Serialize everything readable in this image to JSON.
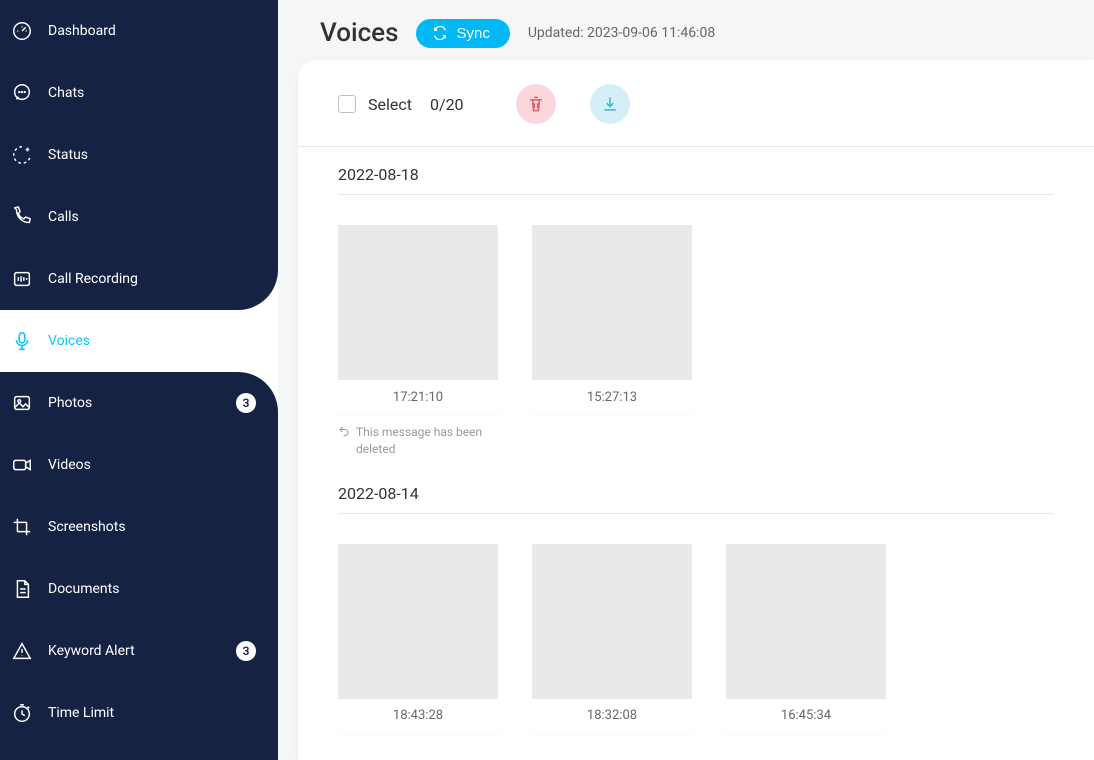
{
  "sidebar": {
    "items": [
      {
        "label": "Dashboard",
        "icon": "dashboard"
      },
      {
        "label": "Chats",
        "icon": "chat"
      },
      {
        "label": "Status",
        "icon": "status"
      },
      {
        "label": "Calls",
        "icon": "call"
      },
      {
        "label": "Call Recording",
        "icon": "recording"
      },
      {
        "label": "Voices",
        "icon": "voice",
        "active": true
      },
      {
        "label": "Photos",
        "icon": "photo",
        "badge": "3"
      },
      {
        "label": "Videos",
        "icon": "video"
      },
      {
        "label": "Screenshots",
        "icon": "screenshot"
      },
      {
        "label": "Documents",
        "icon": "document"
      },
      {
        "label": "Keyword Alert",
        "icon": "alert",
        "badge": "3"
      },
      {
        "label": "Time Limit",
        "icon": "timelimit"
      }
    ]
  },
  "header": {
    "title": "Voices",
    "sync_label": "Sync",
    "updated_label": "Updated: 2023-09-06 11:46:08"
  },
  "toolbar": {
    "select_label": "Select",
    "select_count": "0/20"
  },
  "sections": [
    {
      "date": "2022-08-18",
      "items": [
        {
          "time": "17:21:10",
          "deleted_note": "This message has been deleted"
        },
        {
          "time": "15:27:13"
        }
      ]
    },
    {
      "date": "2022-08-14",
      "items": [
        {
          "time": "18:43:28"
        },
        {
          "time": "18:32:08"
        },
        {
          "time": "16:45:34"
        }
      ]
    }
  ]
}
